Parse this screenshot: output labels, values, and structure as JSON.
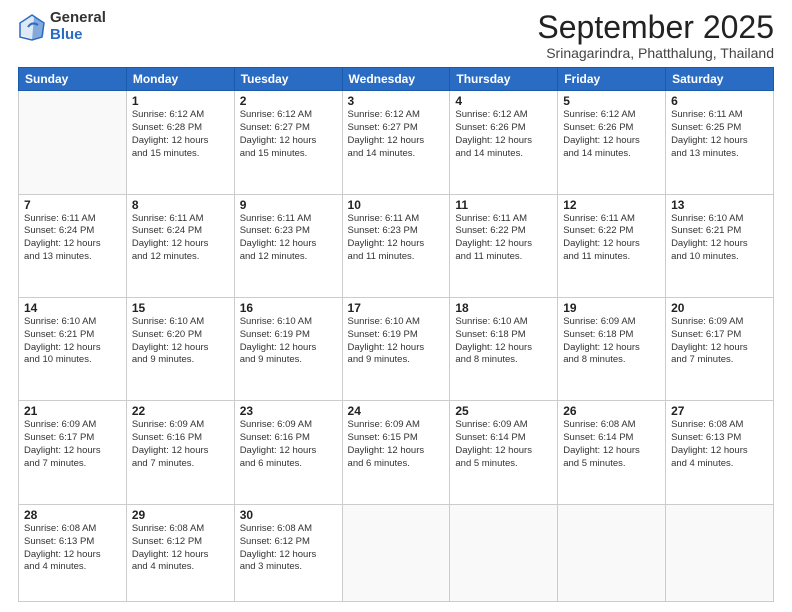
{
  "logo": {
    "general": "General",
    "blue": "Blue"
  },
  "title": "September 2025",
  "location": "Srinagarindra, Phatthalung, Thailand",
  "days_of_week": [
    "Sunday",
    "Monday",
    "Tuesday",
    "Wednesday",
    "Thursday",
    "Friday",
    "Saturday"
  ],
  "weeks": [
    [
      {
        "num": "",
        "info": ""
      },
      {
        "num": "1",
        "info": "Sunrise: 6:12 AM\nSunset: 6:28 PM\nDaylight: 12 hours\nand 15 minutes."
      },
      {
        "num": "2",
        "info": "Sunrise: 6:12 AM\nSunset: 6:27 PM\nDaylight: 12 hours\nand 15 minutes."
      },
      {
        "num": "3",
        "info": "Sunrise: 6:12 AM\nSunset: 6:27 PM\nDaylight: 12 hours\nand 14 minutes."
      },
      {
        "num": "4",
        "info": "Sunrise: 6:12 AM\nSunset: 6:26 PM\nDaylight: 12 hours\nand 14 minutes."
      },
      {
        "num": "5",
        "info": "Sunrise: 6:12 AM\nSunset: 6:26 PM\nDaylight: 12 hours\nand 14 minutes."
      },
      {
        "num": "6",
        "info": "Sunrise: 6:11 AM\nSunset: 6:25 PM\nDaylight: 12 hours\nand 13 minutes."
      }
    ],
    [
      {
        "num": "7",
        "info": "Sunrise: 6:11 AM\nSunset: 6:24 PM\nDaylight: 12 hours\nand 13 minutes."
      },
      {
        "num": "8",
        "info": "Sunrise: 6:11 AM\nSunset: 6:24 PM\nDaylight: 12 hours\nand 12 minutes."
      },
      {
        "num": "9",
        "info": "Sunrise: 6:11 AM\nSunset: 6:23 PM\nDaylight: 12 hours\nand 12 minutes."
      },
      {
        "num": "10",
        "info": "Sunrise: 6:11 AM\nSunset: 6:23 PM\nDaylight: 12 hours\nand 11 minutes."
      },
      {
        "num": "11",
        "info": "Sunrise: 6:11 AM\nSunset: 6:22 PM\nDaylight: 12 hours\nand 11 minutes."
      },
      {
        "num": "12",
        "info": "Sunrise: 6:11 AM\nSunset: 6:22 PM\nDaylight: 12 hours\nand 11 minutes."
      },
      {
        "num": "13",
        "info": "Sunrise: 6:10 AM\nSunset: 6:21 PM\nDaylight: 12 hours\nand 10 minutes."
      }
    ],
    [
      {
        "num": "14",
        "info": "Sunrise: 6:10 AM\nSunset: 6:21 PM\nDaylight: 12 hours\nand 10 minutes."
      },
      {
        "num": "15",
        "info": "Sunrise: 6:10 AM\nSunset: 6:20 PM\nDaylight: 12 hours\nand 9 minutes."
      },
      {
        "num": "16",
        "info": "Sunrise: 6:10 AM\nSunset: 6:19 PM\nDaylight: 12 hours\nand 9 minutes."
      },
      {
        "num": "17",
        "info": "Sunrise: 6:10 AM\nSunset: 6:19 PM\nDaylight: 12 hours\nand 9 minutes."
      },
      {
        "num": "18",
        "info": "Sunrise: 6:10 AM\nSunset: 6:18 PM\nDaylight: 12 hours\nand 8 minutes."
      },
      {
        "num": "19",
        "info": "Sunrise: 6:09 AM\nSunset: 6:18 PM\nDaylight: 12 hours\nand 8 minutes."
      },
      {
        "num": "20",
        "info": "Sunrise: 6:09 AM\nSunset: 6:17 PM\nDaylight: 12 hours\nand 7 minutes."
      }
    ],
    [
      {
        "num": "21",
        "info": "Sunrise: 6:09 AM\nSunset: 6:17 PM\nDaylight: 12 hours\nand 7 minutes."
      },
      {
        "num": "22",
        "info": "Sunrise: 6:09 AM\nSunset: 6:16 PM\nDaylight: 12 hours\nand 7 minutes."
      },
      {
        "num": "23",
        "info": "Sunrise: 6:09 AM\nSunset: 6:16 PM\nDaylight: 12 hours\nand 6 minutes."
      },
      {
        "num": "24",
        "info": "Sunrise: 6:09 AM\nSunset: 6:15 PM\nDaylight: 12 hours\nand 6 minutes."
      },
      {
        "num": "25",
        "info": "Sunrise: 6:09 AM\nSunset: 6:14 PM\nDaylight: 12 hours\nand 5 minutes."
      },
      {
        "num": "26",
        "info": "Sunrise: 6:08 AM\nSunset: 6:14 PM\nDaylight: 12 hours\nand 5 minutes."
      },
      {
        "num": "27",
        "info": "Sunrise: 6:08 AM\nSunset: 6:13 PM\nDaylight: 12 hours\nand 4 minutes."
      }
    ],
    [
      {
        "num": "28",
        "info": "Sunrise: 6:08 AM\nSunset: 6:13 PM\nDaylight: 12 hours\nand 4 minutes."
      },
      {
        "num": "29",
        "info": "Sunrise: 6:08 AM\nSunset: 6:12 PM\nDaylight: 12 hours\nand 4 minutes."
      },
      {
        "num": "30",
        "info": "Sunrise: 6:08 AM\nSunset: 6:12 PM\nDaylight: 12 hours\nand 3 minutes."
      },
      {
        "num": "",
        "info": ""
      },
      {
        "num": "",
        "info": ""
      },
      {
        "num": "",
        "info": ""
      },
      {
        "num": "",
        "info": ""
      }
    ]
  ]
}
